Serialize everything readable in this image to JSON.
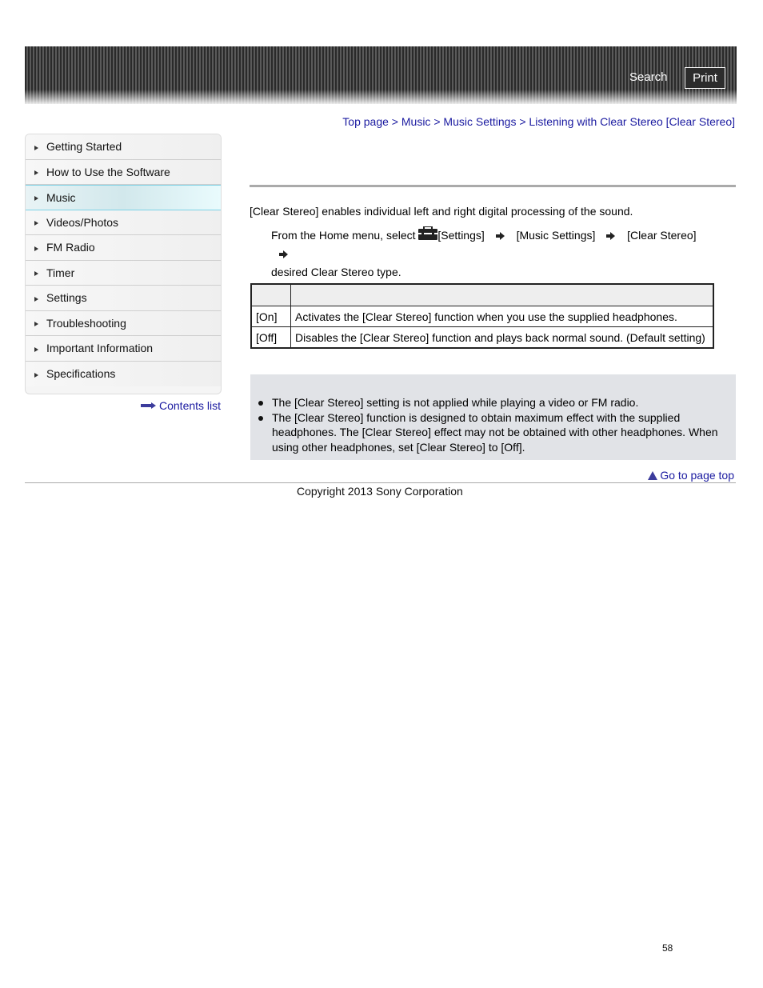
{
  "header": {
    "search_label": "Search",
    "print_label": "Print"
  },
  "breadcrumb": {
    "items": [
      "Top page",
      "Music",
      "Music Settings",
      "Listening with Clear Stereo [Clear Stereo]"
    ],
    "separator": ">"
  },
  "sidebar": {
    "items": [
      {
        "label": "Getting Started"
      },
      {
        "label": "How to Use the Software"
      },
      {
        "label": "Music",
        "active": true
      },
      {
        "label": "Videos/Photos"
      },
      {
        "label": "FM Radio"
      },
      {
        "label": "Timer"
      },
      {
        "label": "Settings"
      },
      {
        "label": "Troubleshooting"
      },
      {
        "label": "Important Information"
      },
      {
        "label": "Specifications"
      }
    ],
    "contents_list_label": "Contents list"
  },
  "main": {
    "intro": "[Clear Stereo] enables individual left and right digital processing of the sound.",
    "step": {
      "prefix": "From the Home menu, select",
      "icon": "toolbox-icon",
      "parts": [
        "[Settings]",
        "[Music Settings]",
        "[Clear Stereo]"
      ],
      "suffix": "desired Clear Stereo type."
    },
    "table": {
      "headers": [
        "",
        ""
      ],
      "rows": [
        {
          "option": "[On]",
          "description": "Activates the [Clear Stereo] function when you use the supplied headphones."
        },
        {
          "option": "[Off]",
          "description": "Disables the [Clear Stereo] function and plays back normal sound. (Default setting)"
        }
      ]
    },
    "hints": [
      "The [Clear Stereo] setting is not applied while playing a video or FM radio.",
      "The [Clear Stereo] function is designed to obtain maximum effect with the supplied headphones. The [Clear Stereo] effect may not be obtained with other headphones. When using other headphones, set [Clear Stereo] to [Off]."
    ]
  },
  "footer": {
    "page_top_label": "Go to page top",
    "copyright": "Copyright 2013 Sony Corporation",
    "page_number": "58"
  }
}
